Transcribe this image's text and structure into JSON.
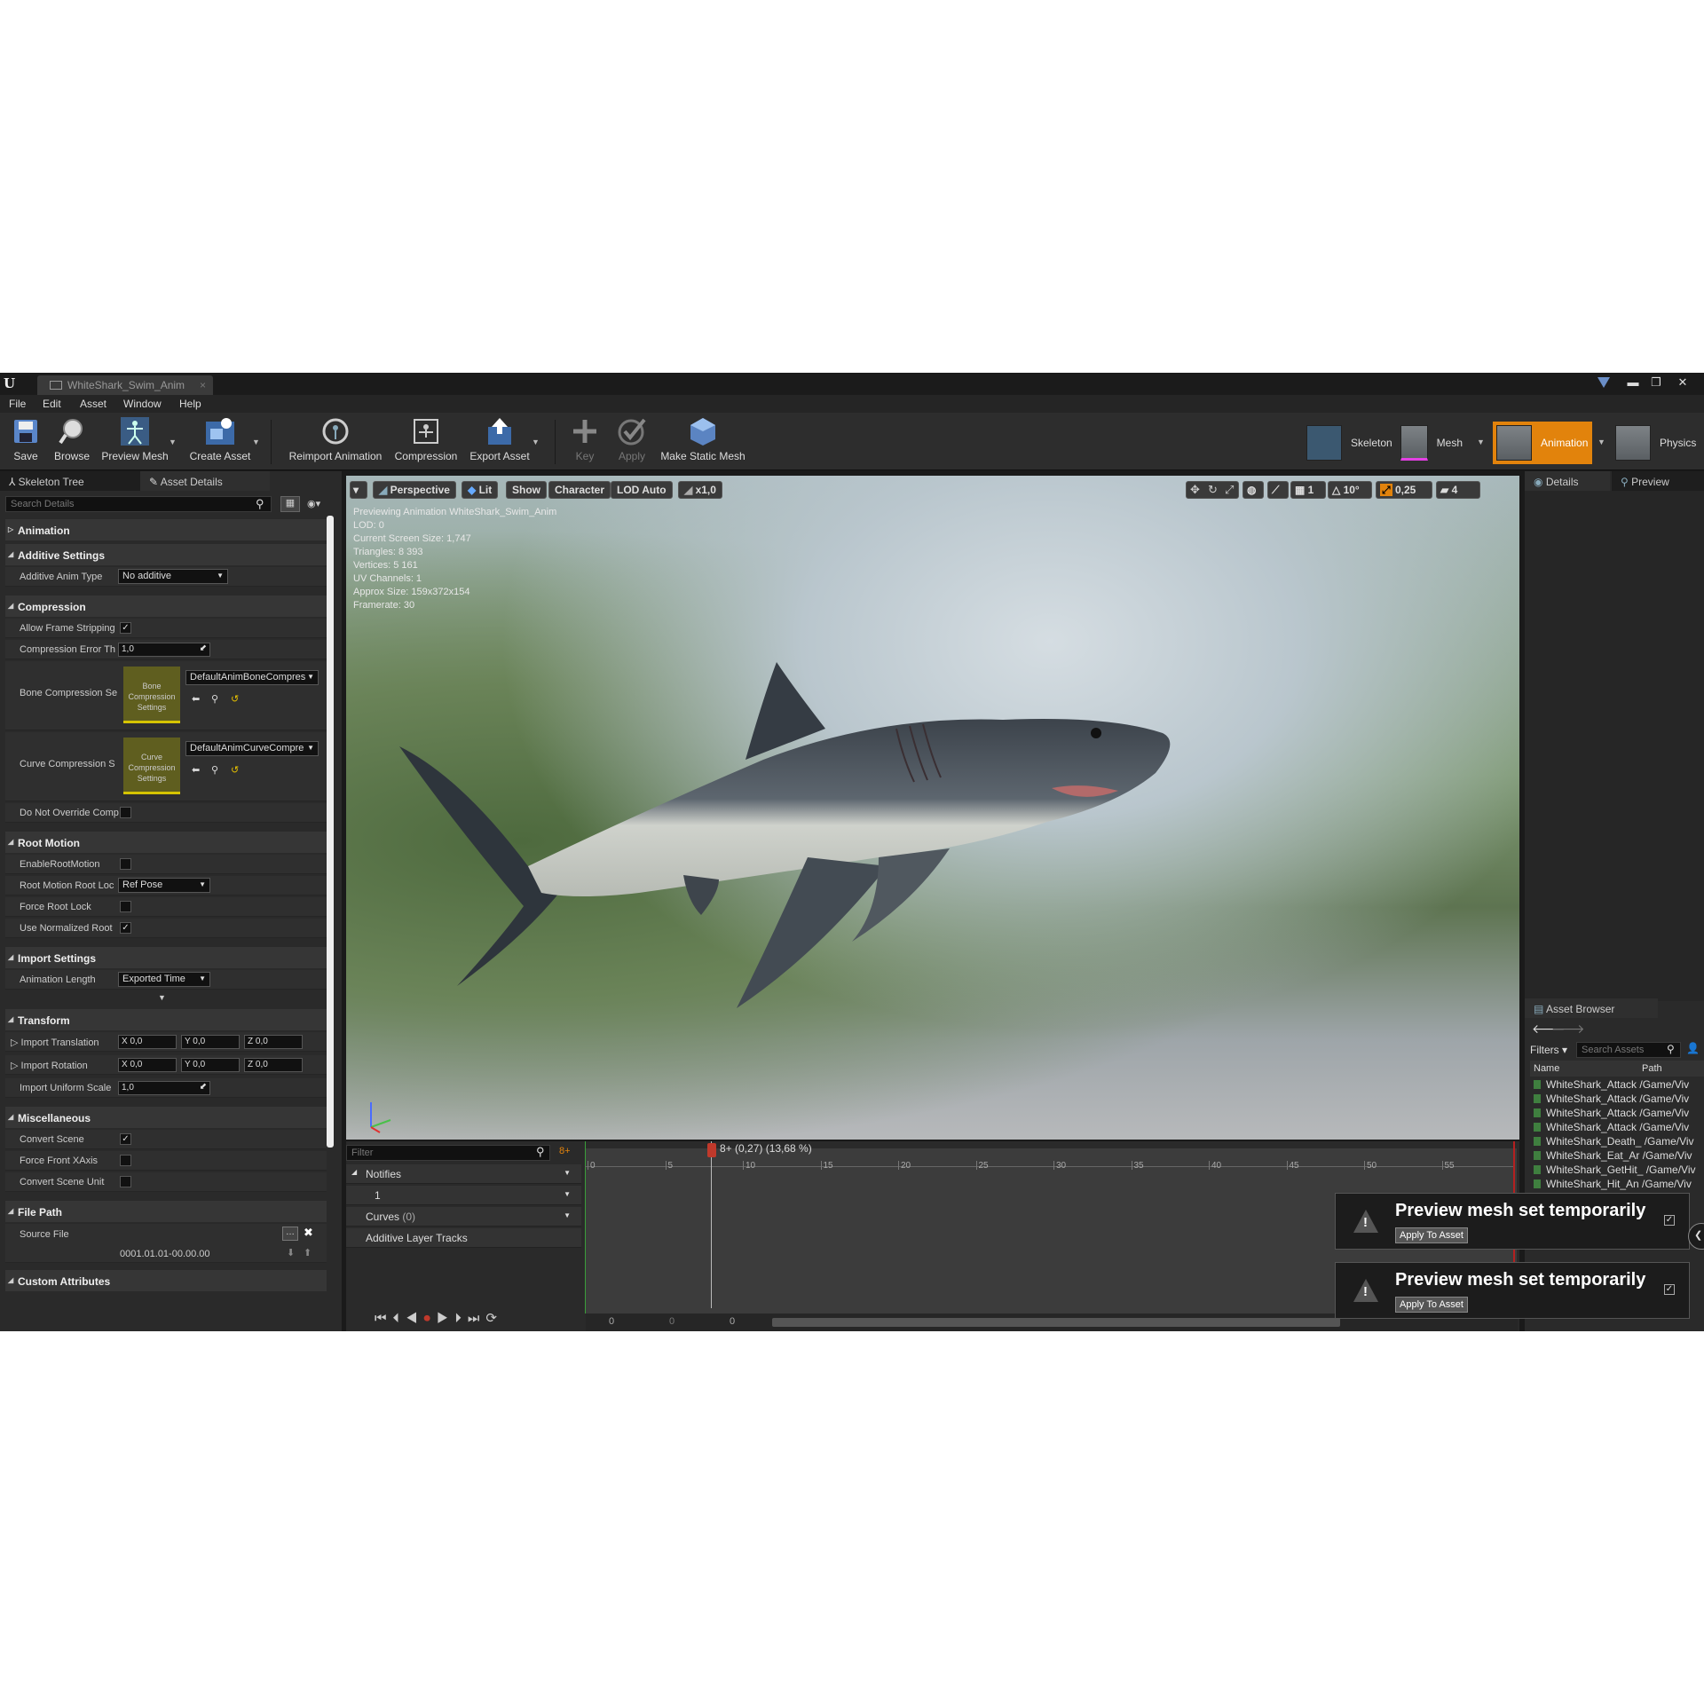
{
  "window": {
    "tab_title": "WhiteShark_Swim_Anim",
    "minimize": "▬",
    "restore": "❐",
    "close": "✕"
  },
  "menu": [
    "File",
    "Edit",
    "Asset",
    "Window",
    "Help"
  ],
  "toolbar": {
    "save": "Save",
    "browse": "Browse",
    "preview_mesh": "Preview Mesh",
    "create_asset": "Create Asset",
    "reimport": "Reimport Animation",
    "compression": "Compression",
    "export_asset": "Export Asset",
    "key": "Key",
    "apply": "Apply",
    "make_static_mesh": "Make Static Mesh"
  },
  "modes": {
    "skeleton": "Skeleton",
    "mesh": "Mesh",
    "animation": "Animation",
    "physics": "Physics"
  },
  "left_tabs": {
    "skeleton_tree": "Skeleton Tree",
    "asset_details": "Asset Details"
  },
  "details": {
    "search_placeholder": "Search Details",
    "cat_animation": "Animation",
    "cat_additive": "Additive Settings",
    "additive_anim_type_label": "Additive Anim Type",
    "additive_anim_type_value": "No additive",
    "cat_compression": "Compression",
    "allow_frame_stripping": "Allow Frame Stripping",
    "compression_error": "Compression Error Th",
    "compression_error_value": "1,0",
    "bone_compression": "Bone Compression Se",
    "bone_thumb": "Bone Compression Settings",
    "bone_value": "DefaultAnimBoneCompres",
    "curve_compression": "Curve Compression S",
    "curve_thumb": "Curve Compression Settings",
    "curve_value": "DefaultAnimCurveCompre",
    "do_not_override": "Do Not Override Comp",
    "cat_root_motion": "Root Motion",
    "enable_root_motion": "EnableRootMotion",
    "root_motion_lock": "Root Motion Root Loc",
    "root_motion_lock_value": "Ref Pose",
    "force_root_lock": "Force Root Lock",
    "use_normalized": "Use Normalized Root",
    "cat_import": "Import Settings",
    "anim_length": "Animation Length",
    "anim_length_value": "Exported Time",
    "cat_transform": "Transform",
    "import_translation": "Import Translation",
    "import_rotation": "Import Rotation",
    "import_uniform_scale": "Import Uniform Scale",
    "scale_value": "1,0",
    "tx": "X  0,0",
    "ty": "Y  0,0",
    "tz": "Z  0,0",
    "cat_misc": "Miscellaneous",
    "convert_scene": "Convert Scene",
    "force_front": "Force Front XAxis",
    "convert_scene_unit": "Convert Scene Unit",
    "cat_file_path": "File Path",
    "source_file": "Source File",
    "source_file_value": "0001.01.01-00.00.00",
    "cat_custom": "Custom Attributes"
  },
  "viewport": {
    "perspective": "Perspective",
    "lit": "Lit",
    "show": "Show",
    "character": "Character",
    "lod": "LOD Auto",
    "speed": "x1,0",
    "grid_angle": "10°",
    "scale_snap": "0,25",
    "cam_speed": "4",
    "grid": "1",
    "info": [
      "Previewing Animation WhiteShark_Swim_Anim",
      "LOD: 0",
      "Current Screen Size: 1,747",
      "Triangles: 8 393",
      "Vertices: 5 161",
      "UV Channels: 1",
      "Approx Size: 159x372x154",
      "Framerate: 30"
    ]
  },
  "timeline": {
    "filter_placeholder": "Filter",
    "plus": "8+",
    "notifies": "Notifies",
    "track1": "1",
    "curves": "Curves",
    "curves_count": "(0)",
    "additive_tracks": "Additive Layer Tracks",
    "scrubber": "8+ (0,27) (13,68 %)",
    "ticks": [
      "0",
      "5",
      "10",
      "15",
      "20",
      "25",
      "30",
      "35",
      "40",
      "45",
      "50",
      "55"
    ],
    "bottom_nums": [
      "0",
      "0",
      "0"
    ]
  },
  "right_tabs": {
    "details": "Details",
    "preview": "Preview"
  },
  "asset_browser": {
    "title": "Asset Browser",
    "filters": "Filters",
    "search_placeholder": "Search Assets",
    "col_name": "Name",
    "col_path": "Path",
    "rows": [
      "WhiteShark_Attack /Game/Viv",
      "WhiteShark_Attack /Game/Viv",
      "WhiteShark_Attack /Game/Viv",
      "WhiteShark_Attack /Game/Viv",
      "WhiteShark_Death_ /Game/Viv",
      "WhiteShark_Eat_Ar /Game/Viv",
      "WhiteShark_GetHit_ /Game/Viv",
      "WhiteShark_Hit_An /Game/Viv"
    ]
  },
  "toasts": [
    {
      "title": "Preview mesh set temporarily",
      "button": "Apply To Asset"
    },
    {
      "title": "Preview mesh set temporarily",
      "button": "Apply To Asset"
    }
  ]
}
